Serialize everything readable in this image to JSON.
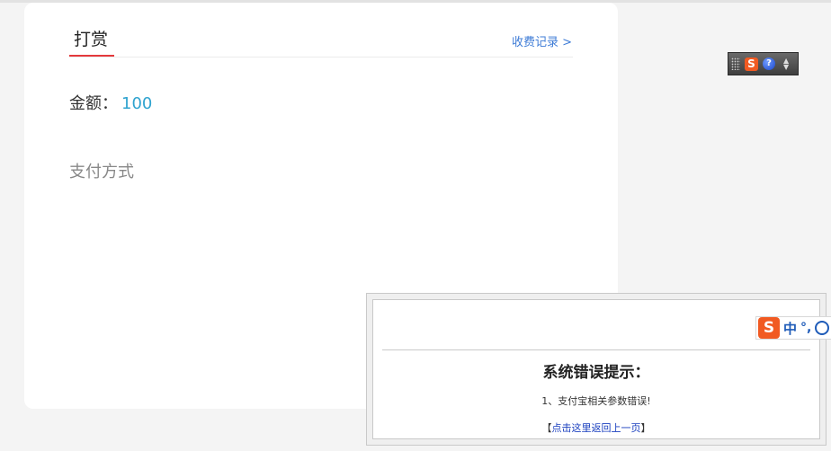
{
  "reward": {
    "tab_title": "打赏",
    "records_link": "收费记录 >",
    "amount_label": "金额：",
    "amount_value": "100",
    "payment_method_label": "支付方式"
  },
  "ime_toolbar": {
    "logo": "S",
    "help": "?"
  },
  "ime_bar": {
    "logo": "S",
    "mode": "中",
    "punct": "°,"
  },
  "error_dialog": {
    "title": "系统错误提示：",
    "message": "1、支付宝相关参数错误!",
    "back_open": "【",
    "back_link": "点击这里返回上一页",
    "back_close": "】"
  },
  "colors": {
    "accent_red": "#e4393c",
    "link_blue": "#3d7bd6",
    "amount_blue": "#2fa3cf",
    "sogou_orange": "#f15a22"
  }
}
